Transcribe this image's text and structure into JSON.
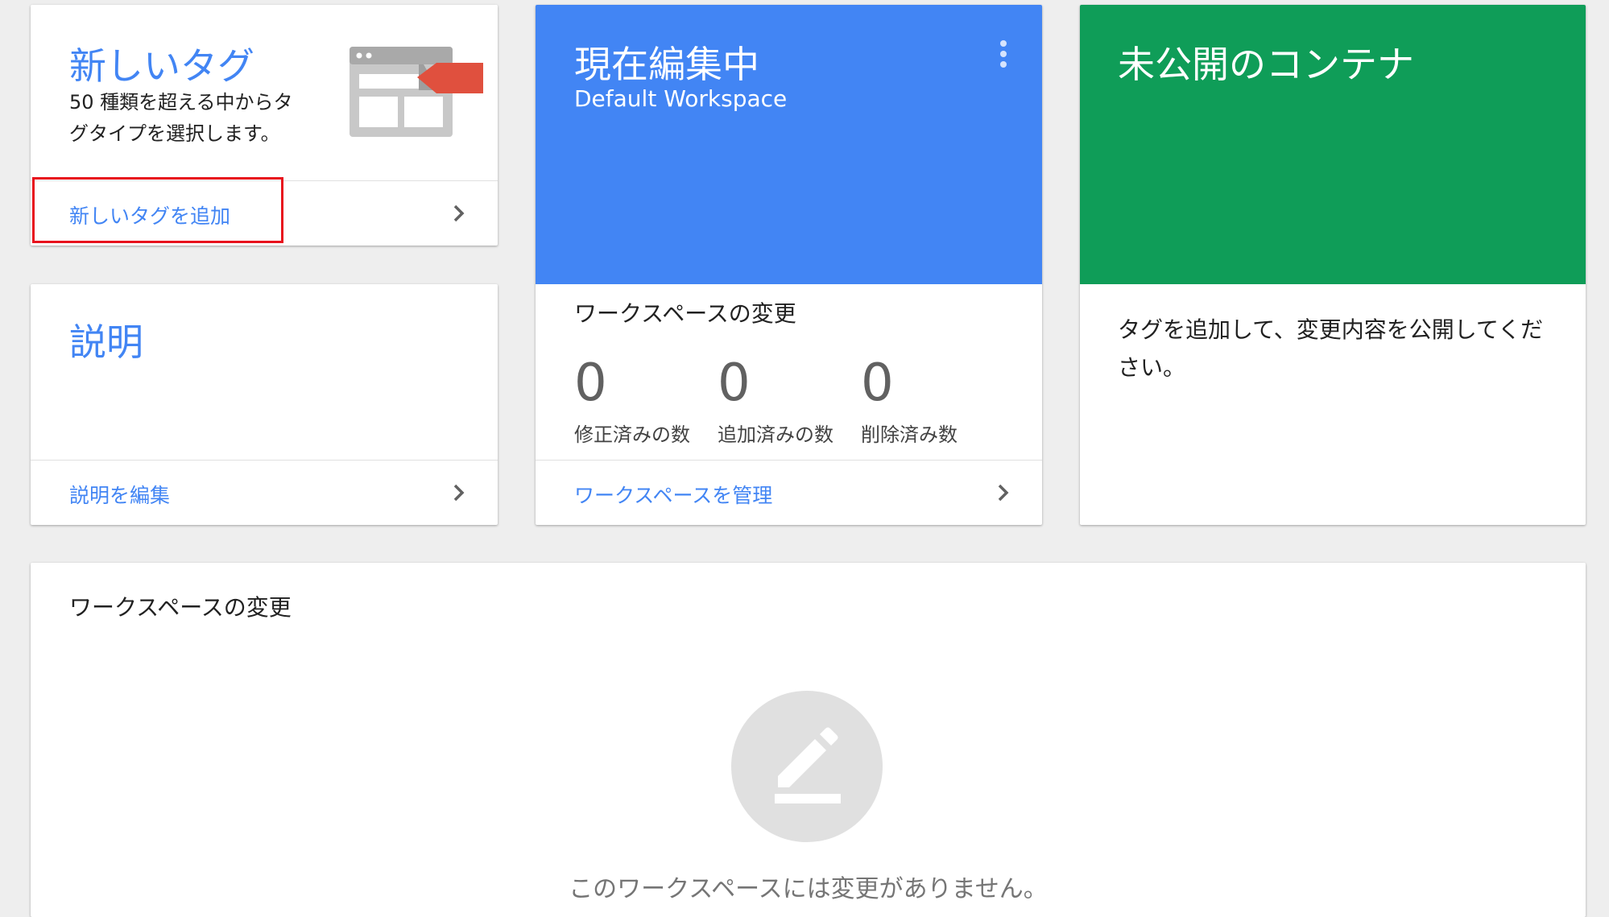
{
  "new_tag_card": {
    "title": "新しいタグ",
    "description": "50 種類を超える中からタグタイプを選択します。",
    "link": "新しいタグを追加",
    "illustration_icon": "tag-browser-illustration-icon"
  },
  "description_card": {
    "title": "説明",
    "link": "説明を編集"
  },
  "workspace_card": {
    "title": "現在編集中",
    "workspace_name": "Default Workspace",
    "changes_label": "ワークスペースの変更",
    "stats": [
      {
        "value": "0",
        "label": "修正済みの数"
      },
      {
        "value": "0",
        "label": "追加済みの数"
      },
      {
        "value": "0",
        "label": "削除済み数"
      }
    ],
    "link": "ワークスペースを管理",
    "accent_color": "#4285f4"
  },
  "unpublished_card": {
    "title": "未公開のコンテナ",
    "message": "タグを追加して、変更内容を公開してください。",
    "accent_color": "#0f9d58"
  },
  "workspace_changes_panel": {
    "title": "ワークスペースの変更",
    "empty_message": "このワークスペースには変更がありません。",
    "empty_icon": "pencil-edit-icon"
  },
  "highlight_color": "#e8111d"
}
